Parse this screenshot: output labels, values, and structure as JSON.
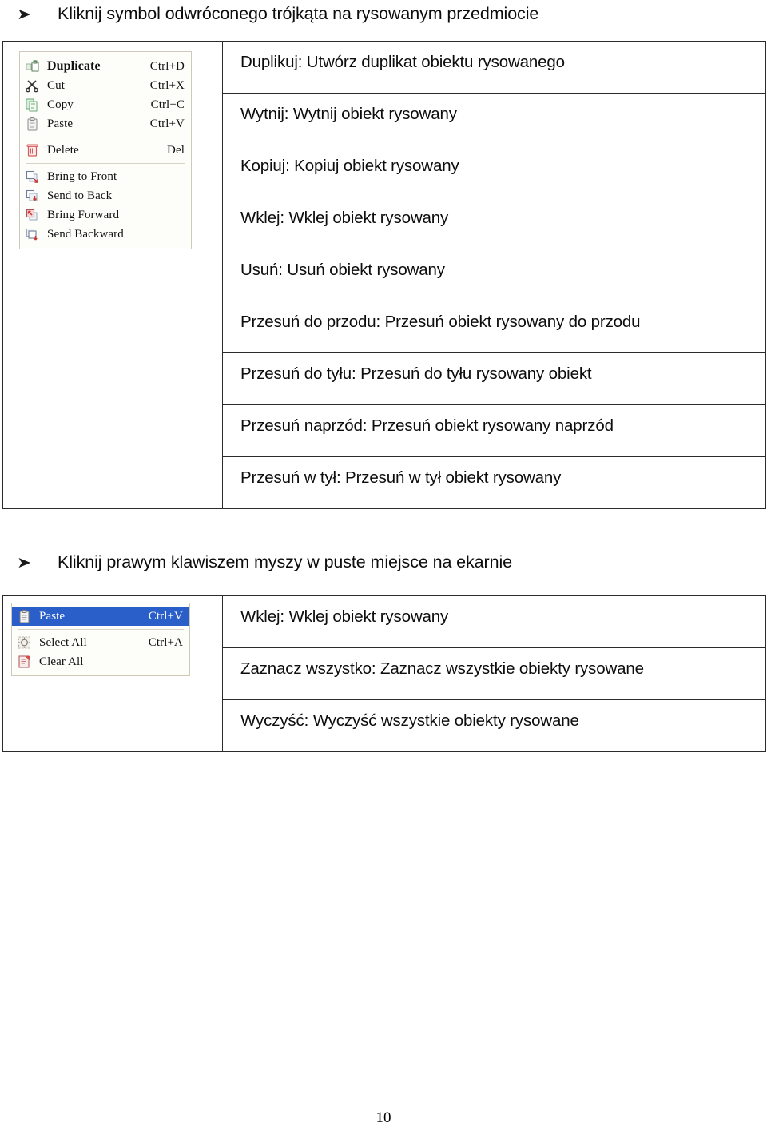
{
  "document": {
    "page_number": "10",
    "bullet_marker": "➤"
  },
  "sections": [
    {
      "heading": "Kliknij symbol odwróconego trójkąta na rysowanym przedmiocie",
      "menu": {
        "name": "object-context-menu",
        "items": [
          {
            "icon": "duplicate-icon",
            "label": "Duplicate",
            "accel": "Ctrl+D",
            "emphasis": "bold",
            "selected": false
          },
          {
            "icon": "cut-scissors-icon",
            "label": "Cut",
            "accel": "Ctrl+X",
            "emphasis": "normal",
            "selected": false
          },
          {
            "icon": "copy-icon",
            "label": "Copy",
            "accel": "Ctrl+C",
            "emphasis": "normal",
            "selected": false
          },
          {
            "icon": "paste-clipboard-icon",
            "label": "Paste",
            "accel": "Ctrl+V",
            "emphasis": "normal",
            "selected": false
          },
          {
            "separator": true
          },
          {
            "icon": "delete-trash-icon",
            "label": "Delete",
            "accel": "Del",
            "emphasis": "normal",
            "selected": false
          },
          {
            "separator": true
          },
          {
            "icon": "bring-to-front-icon",
            "label": "Bring to Front",
            "accel": "",
            "emphasis": "normal",
            "selected": false
          },
          {
            "icon": "send-to-back-icon",
            "label": "Send to Back",
            "accel": "",
            "emphasis": "normal",
            "selected": false
          },
          {
            "icon": "bring-forward-icon",
            "label": "Bring Forward",
            "accel": "",
            "emphasis": "normal",
            "selected": false
          },
          {
            "icon": "send-backward-icon",
            "label": "Send Backward",
            "accel": "",
            "emphasis": "normal",
            "selected": false
          }
        ]
      },
      "descriptions": [
        "Duplikuj: Utwórz duplikat obiektu rysowanego",
        "Wytnij: Wytnij obiekt rysowany",
        "Kopiuj: Kopiuj obiekt rysowany",
        "Wklej: Wklej obiekt rysowany",
        "Usuń: Usuń obiekt rysowany",
        "Przesuń do przodu: Przesuń obiekt rysowany do przodu",
        "Przesuń do tyłu: Przesuń do tyłu rysowany obiekt",
        "Przesuń naprzód: Przesuń obiekt rysowany naprzód",
        "Przesuń w tył: Przesuń w tył obiekt rysowany"
      ]
    },
    {
      "heading": "Kliknij prawym klawiszem myszy w puste miejsce na ekarnie",
      "menu": {
        "name": "canvas-context-menu",
        "items": [
          {
            "icon": "paste-clipboard-icon",
            "label": "Paste",
            "accel": "Ctrl+V",
            "emphasis": "normal",
            "selected": true
          },
          {
            "separator": true
          },
          {
            "icon": "select-all-icon",
            "label": "Select All",
            "accel": "Ctrl+A",
            "emphasis": "normal",
            "selected": false
          },
          {
            "icon": "clear-all-icon",
            "label": "Clear All",
            "accel": "",
            "emphasis": "normal",
            "selected": false
          }
        ]
      },
      "descriptions": [
        "Wklej: Wklej obiekt rysowany",
        "Zaznacz wszystko: Zaznacz wszystkie obiekty rysowane",
        "Wyczyść: Wyczyść wszystkie obiekty rysowane"
      ]
    }
  ],
  "colors": {
    "selection_blue": "#2a5fc9",
    "table_border": "#2b2b2b",
    "menu_background": "#fdfdfa",
    "menu_border": "#cfc9b8"
  }
}
